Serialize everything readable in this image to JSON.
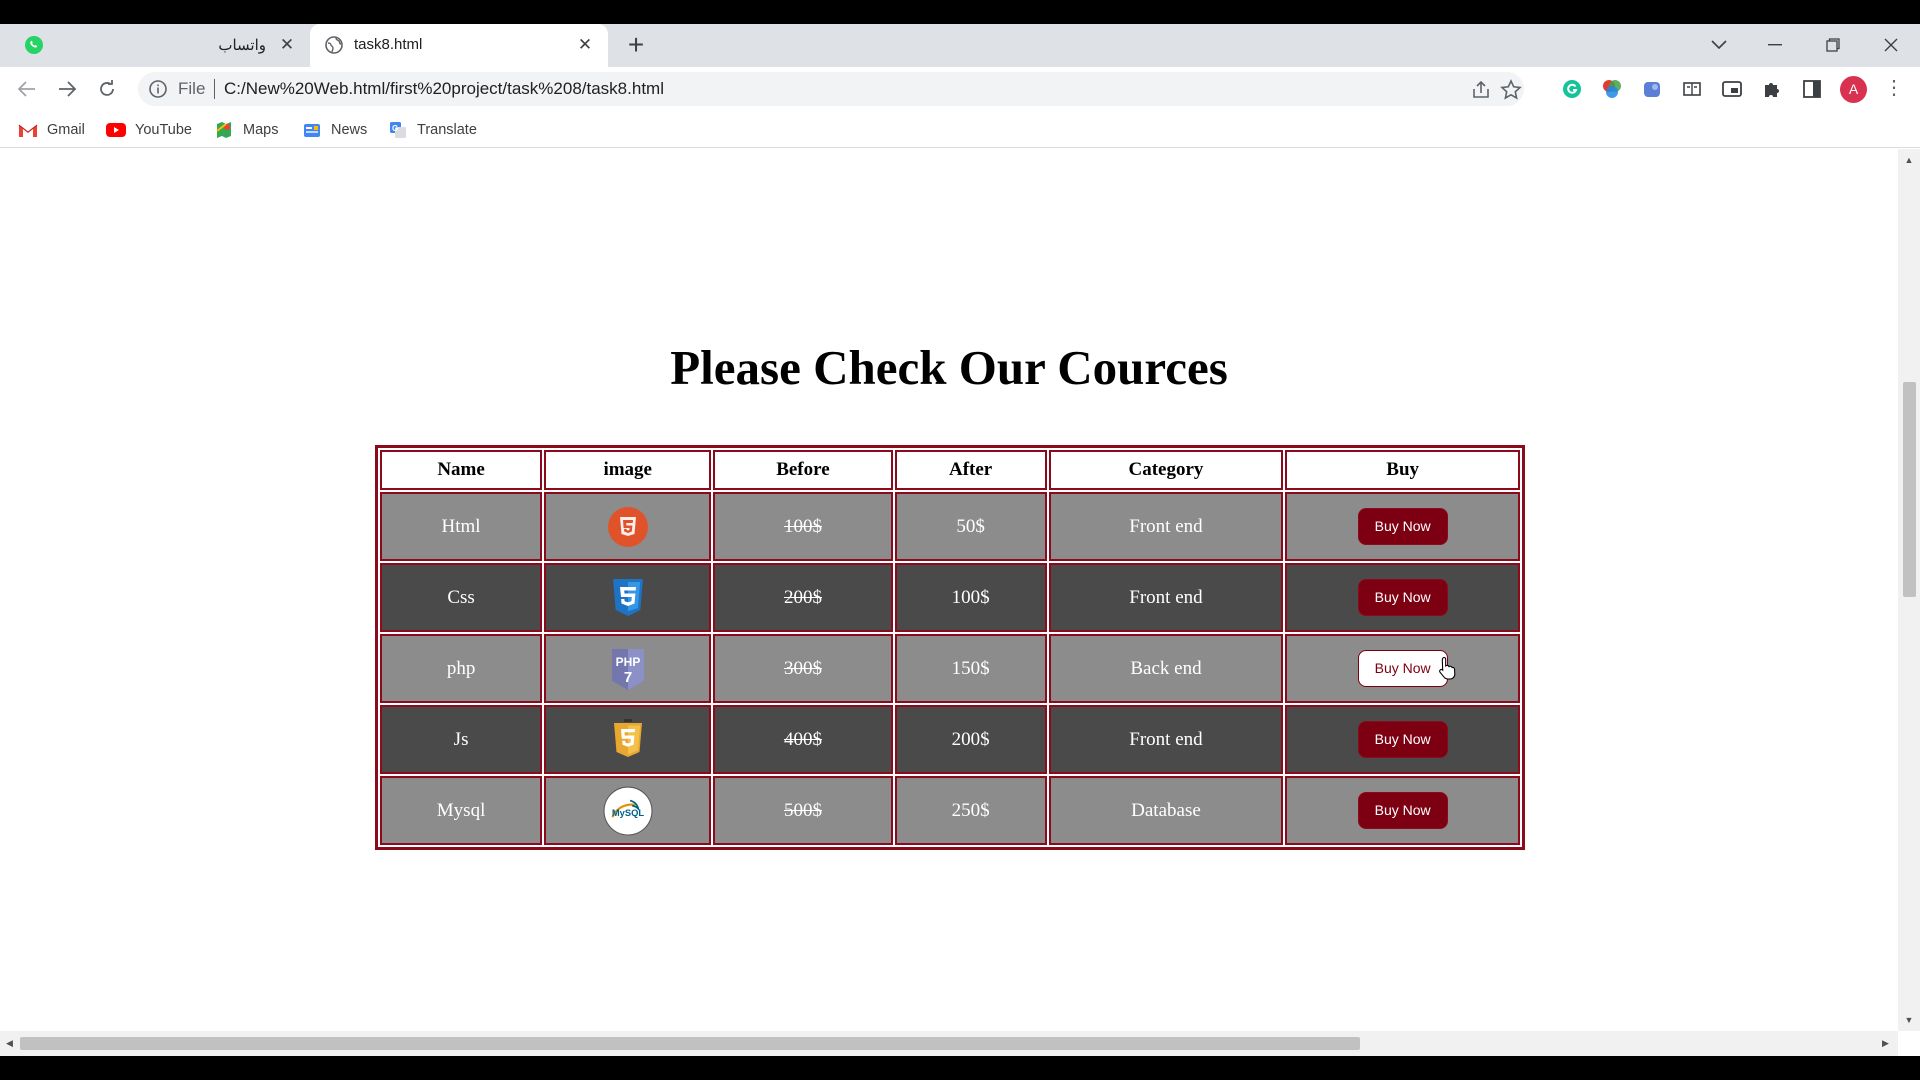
{
  "browser": {
    "tabs": [
      {
        "title": "واتساب",
        "active": false
      },
      {
        "title": "task8.html",
        "active": true
      }
    ],
    "address": {
      "scheme_label": "File",
      "url": "C:/New%20Web.html/first%20project/task%208/task8.html"
    },
    "profile_initial": "A",
    "bookmarks": [
      "Gmail",
      "YouTube",
      "Maps",
      "News",
      "Translate"
    ]
  },
  "page": {
    "title": "Please Check Our Cources",
    "table": {
      "headers": [
        "Name",
        "image",
        "Before",
        "After",
        "Category",
        "Buy"
      ],
      "rows": [
        {
          "name": "Html",
          "icon": "html-logo-icon",
          "before": "100$",
          "after": "50$",
          "category": "Front end",
          "buy": "Buy Now"
        },
        {
          "name": "Css",
          "icon": "css3-logo-icon",
          "before": "200$",
          "after": "100$",
          "category": "Front end",
          "buy": "Buy Now"
        },
        {
          "name": "php",
          "icon": "php7-logo-icon",
          "before": "300$",
          "after": "150$",
          "category": "Back end",
          "buy": "Buy Now"
        },
        {
          "name": "Js",
          "icon": "js-logo-icon",
          "before": "400$",
          "after": "200$",
          "category": "Front end",
          "buy": "Buy Now"
        },
        {
          "name": "Mysql",
          "icon": "mysql-logo-icon",
          "before": "500$",
          "after": "250$",
          "category": "Database",
          "buy": "Buy Now"
        }
      ]
    }
  },
  "colors": {
    "border": "#8b0a1c",
    "button": "#7d0012",
    "row_light": "#8c8c8c",
    "row_dark": "#4a4a4a"
  }
}
